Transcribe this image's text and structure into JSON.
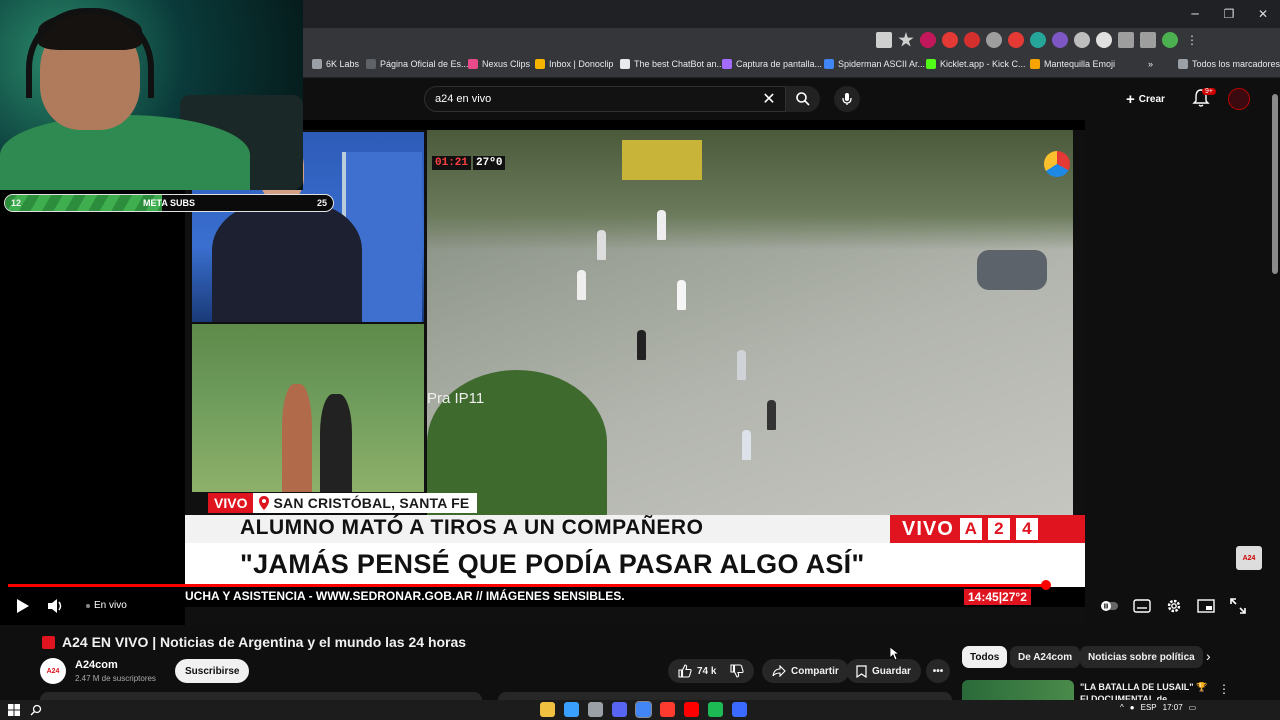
{
  "browser": {
    "window_controls": {
      "minimize": "─",
      "restore": "❐",
      "close": "✕"
    },
    "bookmarks": [
      {
        "label": "6K Labs",
        "color": "#9aa0a6"
      },
      {
        "label": "Página Oficial de Es...",
        "color": "#5f6368"
      },
      {
        "label": "Nexus Clips",
        "color": "#e94b8a"
      },
      {
        "label": "Inbox | Donoclip",
        "color": "#f4b400"
      },
      {
        "label": "The best ChatBot an...",
        "color": "#e8eaed"
      },
      {
        "label": "Captura de pantalla...",
        "color": "#a56bff"
      },
      {
        "label": "Spiderman ASCII Ar...",
        "color": "#4285f4"
      },
      {
        "label": "Kicklet.app - Kick C...",
        "color": "#53fc18"
      },
      {
        "label": "Mantequilla Emoji",
        "color": "#f4a300"
      }
    ],
    "bookmarks_more": "»",
    "all_bookmarks": "Todos los marcadores"
  },
  "youtube": {
    "search": {
      "value": "a24 en vivo"
    },
    "create_label": "Crear",
    "notif_badge": "9+"
  },
  "overlay": {
    "meta_left": "12",
    "meta_label": "META SUBS",
    "meta_right": "25",
    "meta_fill_fraction": 0.48
  },
  "broadcast": {
    "cctv_time": "01:21",
    "cctv_temp": "27º0",
    "cctv_cam": "Pra IP11",
    "vivo_tag": "VIVO",
    "location": "SAN CRISTÓBAL, SANTA FE",
    "headline": "ALUMNO MATÓ A TIROS A UN COMPAÑERO",
    "vivo_label": "VIVO",
    "a24_letters": [
      "A",
      "2",
      "4"
    ],
    "quote": "\"JAMÁS PENSÉ QUE PODÍA PASAR ALGO ASÍ\"",
    "ticker": "UCHA Y ASISTENCIA - WWW.SEDRONAR.GOB.AR // IMÁGENES SENSIBLES.",
    "ticker_clock": "14:45|27°2",
    "watermark": "A24"
  },
  "player": {
    "live_label": "En vivo",
    "progress_fraction": 0.965
  },
  "video": {
    "title": "A24 EN VIVO | Noticias de Argentina y el mundo las 24 horas",
    "channel_name": "A24com",
    "channel_avatar": "A24",
    "subscribers": "2.47 M de suscriptores",
    "subscribe_label": "Suscribirse",
    "likes": "74 k",
    "share_label": "Compartir",
    "save_label": "Guardar",
    "more_label": "•••"
  },
  "sidebar": {
    "chips": [
      "Todos",
      "De A24com",
      "Noticias sobre política"
    ],
    "next": "›",
    "rec_title": "\"LA BATALLA DE LUSAIL\" 🏆 El DOCUMENTAL de ARGENTINA",
    "rec_menu": "⋮"
  },
  "taskbar": {
    "lang": "ESP",
    "time": "17:07",
    "apps": [
      "#f0c040",
      "#3aa0ff",
      "#9aa0a6",
      "#5865f2",
      "#4285f4",
      "#ff3b30",
      "#ff0000",
      "#1db954",
      "#3a6aff"
    ]
  }
}
